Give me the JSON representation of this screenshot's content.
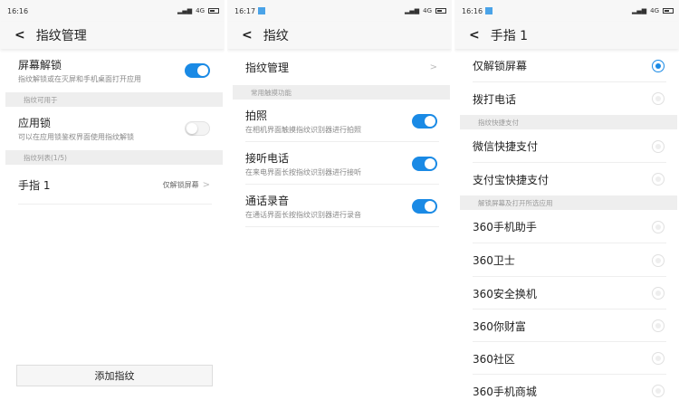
{
  "p1": {
    "time": "16:16",
    "net": "4G",
    "title": "指纹管理",
    "screen_unlock": {
      "title": "屏幕解锁",
      "sub": "指纹解锁或在灭屏和手机桌面打开应用",
      "on": true
    },
    "sec1": "指纹可用于",
    "app_lock": {
      "title": "应用锁",
      "sub": "可以在应用锁鉴权界面使用指纹解锁",
      "on": false
    },
    "sec2": "指纹列表(1/5)",
    "finger": {
      "title": "手指 1",
      "value": "仅解锁屏幕"
    },
    "add": "添加指纹"
  },
  "p2": {
    "time": "16:17",
    "net": "4G",
    "title": "指纹",
    "manage": "指纹管理",
    "sec": "常用触摸功能",
    "items": [
      {
        "title": "拍照",
        "sub": "在相机界面触摸指纹识别器进行拍照",
        "on": true
      },
      {
        "title": "接听电话",
        "sub": "在来电界面长按指纹识别器进行接听",
        "on": true
      },
      {
        "title": "通话录音",
        "sub": "在通话界面长按指纹识别器进行录音",
        "on": true
      }
    ]
  },
  "p3": {
    "time": "16:16",
    "net": "4G",
    "title": "手指 1",
    "g1": [
      "仅解锁屏幕",
      "拨打电话"
    ],
    "sec1": "指纹快捷支付",
    "g2": [
      "微信快捷支付",
      "支付宝快捷支付"
    ],
    "sec2": "解锁屏幕及打开所选应用",
    "g3": [
      "360手机助手",
      "360卫士",
      "360安全换机",
      "360你财富",
      "360社区",
      "360手机商城"
    ],
    "selected": "仅解锁屏幕"
  },
  "colors": {
    "accent": "#1a8ae5"
  }
}
